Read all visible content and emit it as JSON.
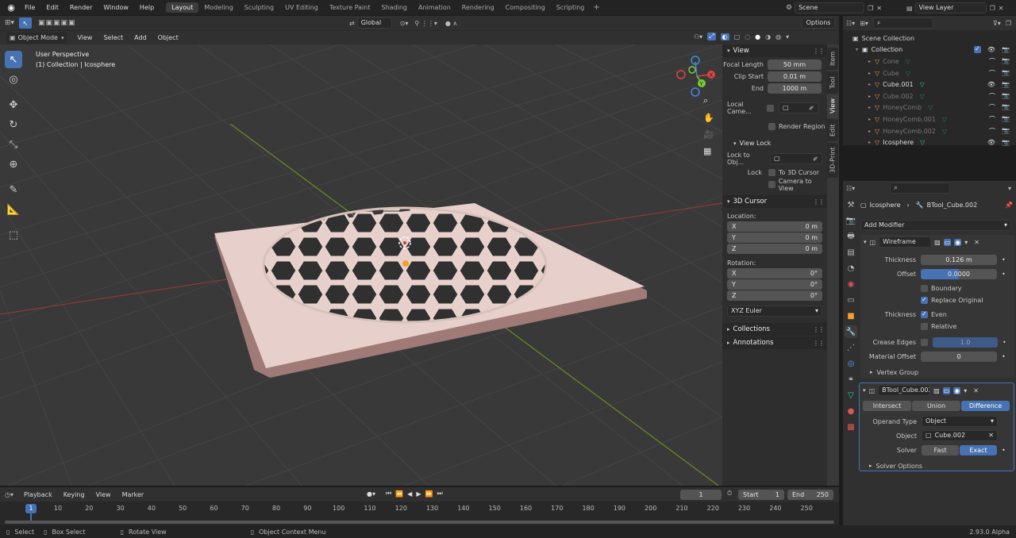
{
  "topbar": {
    "menus": [
      "File",
      "Edit",
      "Render",
      "Window",
      "Help"
    ],
    "workspaces": [
      "Layout",
      "Modeling",
      "Sculpting",
      "UV Editing",
      "Texture Paint",
      "Shading",
      "Animation",
      "Rendering",
      "Compositing",
      "Scripting"
    ],
    "active_workspace": "Layout",
    "add_tab": "+",
    "scene": "Scene",
    "view_layer": "View Layer"
  },
  "viewport_header": {
    "mode": "Object Mode",
    "menus": [
      "View",
      "Select",
      "Add",
      "Object"
    ],
    "orientation": "Global",
    "options": "Options"
  },
  "viewport": {
    "perspective": "User Perspective",
    "collection_info": "(1) Collection | Icosphere",
    "gizmo": {
      "x": "X",
      "y": "Y",
      "z": "Z"
    }
  },
  "npanel": {
    "tabs": [
      "Item",
      "Tool",
      "View",
      "Edit",
      "3D-Print"
    ],
    "active_tab": "View",
    "view": {
      "title": "View",
      "focal_length_label": "Focal Length",
      "focal_length": "50 mm",
      "clip_start_label": "Clip Start",
      "clip_start": "0.01 m",
      "end_label": "End",
      "end": "1000 m",
      "local_camera_label": "Local Came...",
      "render_region": "Render Region"
    },
    "view_lock": {
      "title": "View Lock",
      "lock_to_object_label": "Lock to Obj...",
      "lock_label": "Lock",
      "to_3d_cursor": "To 3D Cursor",
      "camera_to_view": "Camera to View"
    },
    "cursor": {
      "title": "3D Cursor",
      "location_label": "Location:",
      "x": "0 m",
      "y": "0 m",
      "z": "0 m",
      "rotation_label": "Rotation:",
      "rx": "0°",
      "ry": "0°",
      "rz": "0°",
      "axis_x": "X",
      "axis_y": "Y",
      "axis_z": "Z",
      "rotation_mode": "XYZ Euler"
    },
    "collections": "Collections",
    "annotations": "Annotations"
  },
  "outliner": {
    "scene_collection": "Scene Collection",
    "items": [
      {
        "name": "Collection",
        "level": 0,
        "dim": false
      },
      {
        "name": "Cone",
        "level": 1,
        "dim": true
      },
      {
        "name": "Cube",
        "level": 1,
        "dim": true
      },
      {
        "name": "Cube.001",
        "level": 1,
        "dim": false
      },
      {
        "name": "Cube.002",
        "level": 1,
        "dim": true
      },
      {
        "name": "HoneyComb",
        "level": 1,
        "dim": true
      },
      {
        "name": "HoneyComb.001",
        "level": 1,
        "dim": true
      },
      {
        "name": "HoneyComb.002",
        "level": 1,
        "dim": true
      },
      {
        "name": "Icosphere",
        "level": 1,
        "dim": false
      }
    ]
  },
  "properties": {
    "object_name": "Icosphere",
    "modifier_context": "BTool_Cube.002",
    "add_modifier": "Add Modifier",
    "wireframe": {
      "name": "Wireframe",
      "thickness_label": "Thickness",
      "thickness": "0.126 m",
      "offset_label": "Offset",
      "offset": "0.0000",
      "boundary": "Boundary",
      "replace_original": "Replace Original",
      "thickness2_label": "Thickness",
      "even": "Even",
      "relative": "Relative",
      "crease_edges_label": "Crease Edges",
      "crease_value": "1.0",
      "material_offset_label": "Material Offset",
      "material_offset": "0",
      "vertex_group": "Vertex Group"
    },
    "boolean": {
      "name": "BTool_Cube.002",
      "ops": [
        "Intersect",
        "Union",
        "Difference"
      ],
      "active_op": "Difference",
      "operand_type_label": "Operand Type",
      "operand_type": "Object",
      "object_label": "Object",
      "object": "Cube.002",
      "solver_label": "Solver",
      "solvers": [
        "Fast",
        "Exact"
      ],
      "active_solver": "Exact",
      "solver_options": "Solver Options"
    }
  },
  "timeline": {
    "menus": [
      "Playback",
      "Keying",
      "View",
      "Marker"
    ],
    "current_frame": "1",
    "start_label": "Start",
    "start": "1",
    "end_label": "End",
    "end": "250",
    "ticks": [
      "1",
      "10",
      "20",
      "30",
      "40",
      "50",
      "60",
      "70",
      "80",
      "90",
      "100",
      "110",
      "120",
      "130",
      "140",
      "150",
      "160",
      "170",
      "180",
      "190",
      "200",
      "210",
      "220",
      "230",
      "240",
      "250"
    ]
  },
  "statusbar": {
    "select": "Select",
    "box_select": "Box Select",
    "rotate_view": "Rotate View",
    "context_menu": "Object Context Menu",
    "version": "2.93.0 Alpha"
  }
}
